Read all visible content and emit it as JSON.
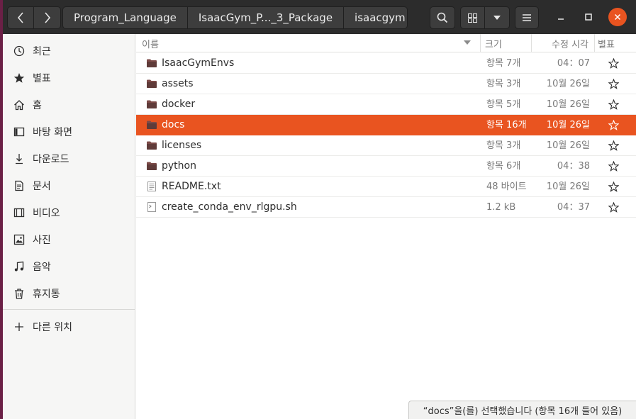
{
  "nav": {
    "back_icon": "chevron-left-icon",
    "forward_icon": "chevron-right-icon"
  },
  "pathbar": {
    "crumbs": [
      "Program_Language",
      "IsaacGym_P..._3_Package",
      "isaacgym"
    ]
  },
  "sidebar": {
    "items": [
      {
        "label": "최근",
        "icon": "clock-icon"
      },
      {
        "label": "별표",
        "icon": "star-icon"
      },
      {
        "label": "홈",
        "icon": "home-icon"
      },
      {
        "label": "바탕 화면",
        "icon": "desktop-icon"
      },
      {
        "label": "다운로드",
        "icon": "download-icon"
      },
      {
        "label": "문서",
        "icon": "document-icon"
      },
      {
        "label": "비디오",
        "icon": "video-icon"
      },
      {
        "label": "사진",
        "icon": "photo-icon"
      },
      {
        "label": "음악",
        "icon": "music-icon"
      },
      {
        "label": "휴지통",
        "icon": "trash-icon"
      }
    ],
    "other_locations": "다른 위치"
  },
  "columns": {
    "name": "이름",
    "size": "크기",
    "modified": "수정 시각",
    "starred": "별표"
  },
  "files": [
    {
      "name": "IsaacGymEnvs",
      "type": "folder",
      "size": "항목 7개",
      "modified": "04：07"
    },
    {
      "name": "assets",
      "type": "folder",
      "size": "항목 3개",
      "modified": "10월 26일"
    },
    {
      "name": "docker",
      "type": "folder",
      "size": "항목 5개",
      "modified": "10월 26일"
    },
    {
      "name": "docs",
      "type": "folder",
      "size": "항목 16개",
      "modified": "10월 26일",
      "selected": true
    },
    {
      "name": "licenses",
      "type": "folder",
      "size": "항목 3개",
      "modified": "10월 26일"
    },
    {
      "name": "python",
      "type": "folder",
      "size": "항목 6개",
      "modified": "04：38"
    },
    {
      "name": "README.txt",
      "type": "text",
      "size": "48 바이트",
      "modified": "10월 26일"
    },
    {
      "name": "create_conda_env_rlgpu.sh",
      "type": "script",
      "size": "1.2 kB",
      "modified": "04：37"
    }
  ],
  "status": "“docs”을(를) 선택했습니다 (항목 16개 들어 있음)",
  "colors": {
    "accent": "#e95420",
    "headerbar": "#2c2c2c",
    "folder": "#7d4b48"
  }
}
